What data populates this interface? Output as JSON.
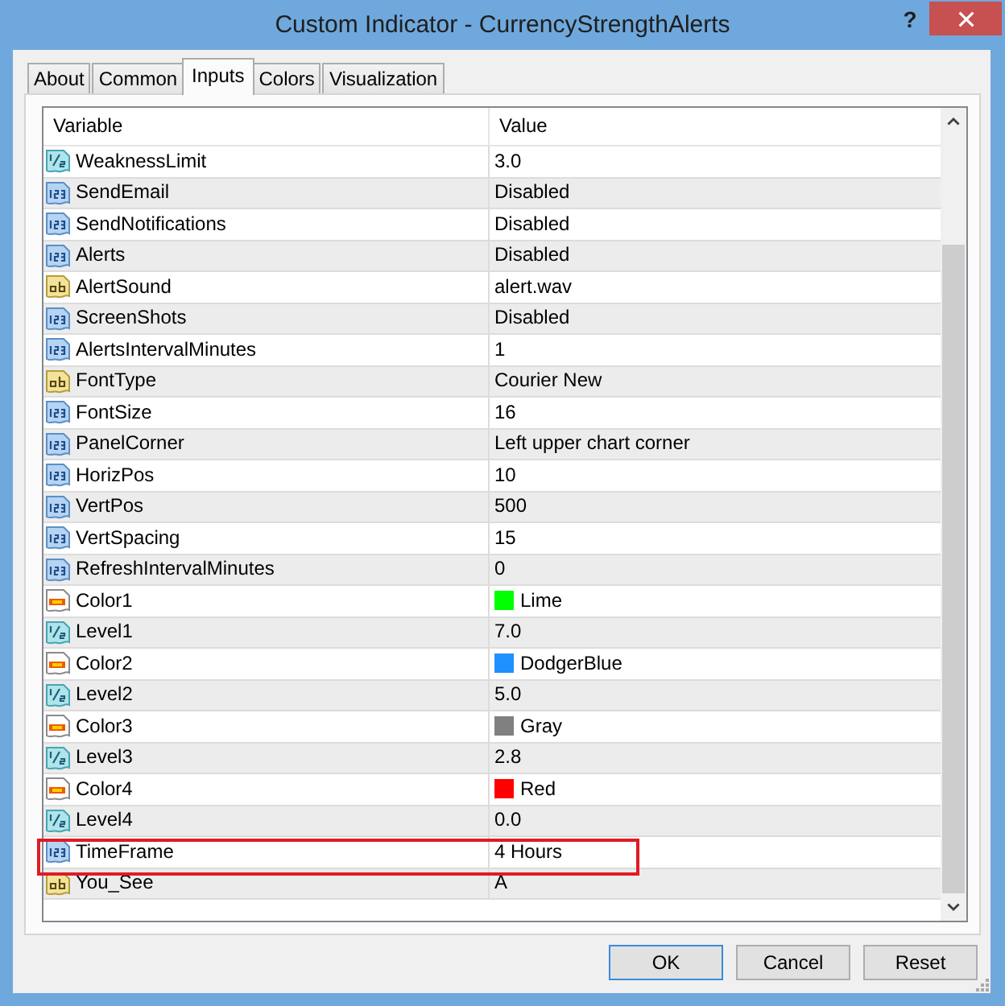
{
  "window": {
    "title": "Custom Indicator - CurrencyStrengthAlerts",
    "help": "?"
  },
  "tabs": [
    {
      "label": "About",
      "selected": false
    },
    {
      "label": "Common",
      "selected": false
    },
    {
      "label": "Inputs",
      "selected": true
    },
    {
      "label": "Colors",
      "selected": false
    },
    {
      "label": "Visualization",
      "selected": false
    }
  ],
  "table": {
    "columns": [
      "Variable",
      "Value"
    ],
    "rows": [
      {
        "kind": "double",
        "variable": "WeaknessLimit",
        "value": "3.0",
        "highlighted": false
      },
      {
        "kind": "int",
        "variable": "SendEmail",
        "value": "Disabled",
        "highlighted": false
      },
      {
        "kind": "int",
        "variable": "SendNotifications",
        "value": "Disabled",
        "highlighted": false
      },
      {
        "kind": "int",
        "variable": "Alerts",
        "value": "Disabled",
        "highlighted": false
      },
      {
        "kind": "string",
        "variable": "AlertSound",
        "value": "alert.wav",
        "highlighted": false
      },
      {
        "kind": "int",
        "variable": "ScreenShots",
        "value": "Disabled",
        "highlighted": false
      },
      {
        "kind": "int",
        "variable": "AlertsIntervalMinutes",
        "value": "1",
        "highlighted": false
      },
      {
        "kind": "string",
        "variable": "FontType",
        "value": "Courier New",
        "highlighted": false
      },
      {
        "kind": "int",
        "variable": "FontSize",
        "value": "16",
        "highlighted": false
      },
      {
        "kind": "int",
        "variable": "PanelCorner",
        "value": "Left upper chart corner",
        "highlighted": false
      },
      {
        "kind": "int",
        "variable": "HorizPos",
        "value": "10",
        "highlighted": false
      },
      {
        "kind": "int",
        "variable": "VertPos",
        "value": "500",
        "highlighted": false
      },
      {
        "kind": "int",
        "variable": "VertSpacing",
        "value": "15",
        "highlighted": false
      },
      {
        "kind": "int",
        "variable": "RefreshIntervalMinutes",
        "value": "0",
        "highlighted": false
      },
      {
        "kind": "color",
        "variable": "Color1",
        "value": "Lime",
        "color": "#00ff00",
        "highlighted": false
      },
      {
        "kind": "double",
        "variable": "Level1",
        "value": "7.0",
        "highlighted": false
      },
      {
        "kind": "color",
        "variable": "Color2",
        "value": "DodgerBlue",
        "color": "#1e90ff",
        "highlighted": false
      },
      {
        "kind": "double",
        "variable": "Level2",
        "value": "5.0",
        "highlighted": false
      },
      {
        "kind": "color",
        "variable": "Color3",
        "value": "Gray",
        "color": "#808080",
        "highlighted": false
      },
      {
        "kind": "double",
        "variable": "Level3",
        "value": "2.8",
        "highlighted": false
      },
      {
        "kind": "color",
        "variable": "Color4",
        "value": "Red",
        "color": "#ff0000",
        "highlighted": false
      },
      {
        "kind": "double",
        "variable": "Level4",
        "value": "0.0",
        "highlighted": false
      },
      {
        "kind": "int",
        "variable": "TimeFrame",
        "value": "4 Hours",
        "highlighted": true
      },
      {
        "kind": "string",
        "variable": "You_See",
        "value": "A",
        "highlighted": false
      }
    ]
  },
  "buttons": [
    {
      "label": "OK",
      "default": true
    },
    {
      "label": "Cancel",
      "default": false
    },
    {
      "label": "Reset",
      "default": false
    }
  ]
}
